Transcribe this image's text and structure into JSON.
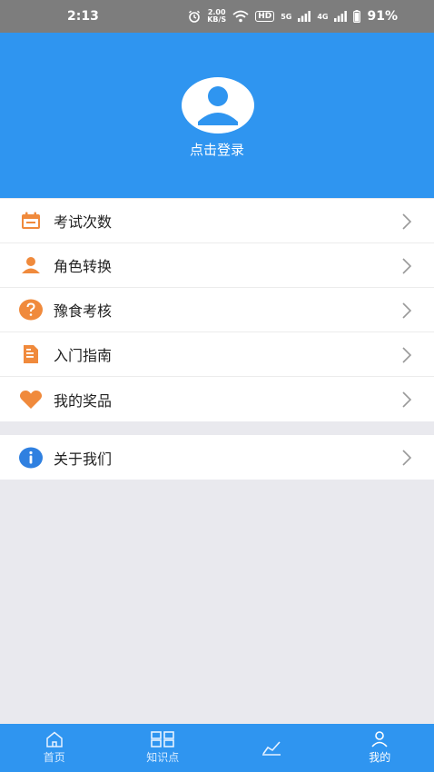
{
  "status_bar": {
    "time": "2:13",
    "net_speed_value": "2.00",
    "net_speed_unit": "KB/S",
    "hd_badge": "HD",
    "signal1_label": "5G",
    "signal2_label": "4G",
    "battery": "91%"
  },
  "header": {
    "login_text": "点击登录"
  },
  "menu": {
    "group1": [
      {
        "label": "考试次数",
        "icon": "calendar-icon",
        "color": "#f08a3c"
      },
      {
        "label": "角色转换",
        "icon": "person-icon",
        "color": "#f08a3c"
      },
      {
        "label": "豫食考核",
        "icon": "question-circle-icon",
        "color": "#f08a3c"
      },
      {
        "label": "入门指南",
        "icon": "document-icon",
        "color": "#f08a3c"
      },
      {
        "label": "我的奖品",
        "icon": "heart-icon",
        "color": "#f08a3c"
      }
    ],
    "group2": [
      {
        "label": "关于我们",
        "icon": "info-circle-icon",
        "color": "#2f80e0"
      }
    ]
  },
  "tabs": [
    {
      "label": "首页",
      "icon": "home-icon"
    },
    {
      "label": "知识点",
      "icon": "grid-icon"
    },
    {
      "label": "",
      "icon": "chart-icon"
    },
    {
      "label": "我的",
      "icon": "user-icon"
    }
  ],
  "colors": {
    "primary": "#2f95f0",
    "accent_orange": "#f08a3c",
    "info_blue": "#2f80e0",
    "background": "#e9e9ee"
  }
}
